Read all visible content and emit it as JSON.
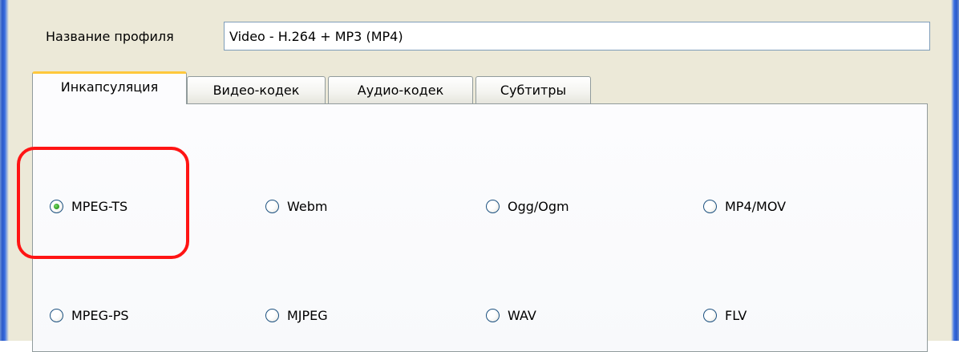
{
  "profile": {
    "label": "Название профиля",
    "value": "Video - H.264 + MP3 (MP4)"
  },
  "tabs": [
    {
      "label": "Инкапсуляция",
      "active": true
    },
    {
      "label": "Видео-кодек",
      "active": false
    },
    {
      "label": "Аудио-кодек",
      "active": false
    },
    {
      "label": "Субтитры",
      "active": false
    }
  ],
  "encapsulation": {
    "options": [
      {
        "label": "MPEG-TS",
        "checked": true
      },
      {
        "label": "Webm",
        "checked": false
      },
      {
        "label": "Ogg/Ogm",
        "checked": false
      },
      {
        "label": "MP4/MOV",
        "checked": false
      },
      {
        "label": "MPEG-PS",
        "checked": false
      },
      {
        "label": "MJPEG",
        "checked": false
      },
      {
        "label": "WAV",
        "checked": false
      },
      {
        "label": "FLV",
        "checked": false
      }
    ]
  },
  "colors": {
    "highlight": "#ff1414",
    "active_tab_accent": "#ffc83c",
    "window_border": "#2a58c8",
    "dialog_background": "#ece9d8"
  }
}
